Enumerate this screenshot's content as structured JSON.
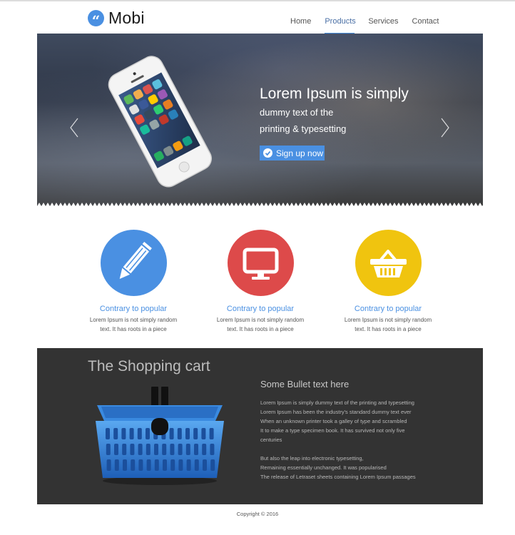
{
  "brand": {
    "name": "Mobi",
    "logo_icon": "quote-icon",
    "accent": "#4a90e2"
  },
  "nav": {
    "items": [
      "Home",
      "Products",
      "Services",
      "Contact"
    ],
    "active": "Products"
  },
  "hero": {
    "title": "Lorem Ipsum is simply",
    "subtitle_line1": "dummy text of the",
    "subtitle_line2": "printing & typesetting",
    "cta_label": "Sign up now",
    "prev_icon": "chevron-left-icon",
    "next_icon": "chevron-right-icon"
  },
  "features": [
    {
      "icon": "pencil-icon",
      "color": "#4a90e2",
      "title": "Contrary to popular",
      "line1": "Lorem Ipsum is not simply random",
      "line2": "text. It has roots in a piece"
    },
    {
      "icon": "monitor-icon",
      "color": "#dd4a4a",
      "title": "Contrary to popular",
      "line1": "Lorem Ipsum is not simply random",
      "line2": "text. It has roots in a piece"
    },
    {
      "icon": "basket-icon",
      "color": "#f0c40f",
      "title": "Contrary to popular",
      "line1": "Lorem Ipsum is not simply random",
      "line2": "text. It has roots in a piece"
    }
  ],
  "cart": {
    "title": "The Shopping cart",
    "bullet_heading": "Some Bullet text here",
    "lines": [
      "Lorem Ipsum is simply dummy text of the printing and typesetting",
      "Lorem Ipsum has been the industry's standard dummy text ever",
      "When an unknown printer took a galley of type and scrambled",
      "It to make a type specimen book. It has survived not only five",
      "centuries",
      "",
      "But also the leap into electronic typesetting,",
      "Remaining essentially unchanged. It was popularised",
      "The release of Letraset sheets containing Lorem Ipsum passages"
    ]
  },
  "footer": {
    "copyright": "Copyright © 2016"
  }
}
